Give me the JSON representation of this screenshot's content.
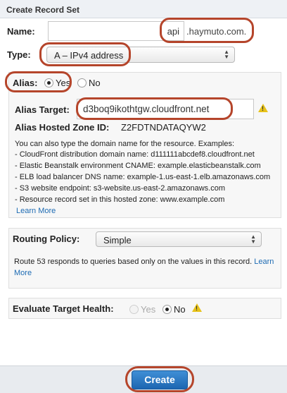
{
  "panel": {
    "title": "Create Record Set"
  },
  "name": {
    "label": "Name:",
    "value": "api",
    "suffix": ".haymuto.com."
  },
  "type": {
    "label": "Type:",
    "selected": "A – IPv4 address"
  },
  "alias": {
    "label": "Alias:",
    "yes_label": "Yes",
    "no_label": "No",
    "selected": "Yes",
    "target_label": "Alias Target:",
    "target_value": "d3boq9ikothtgw.cloudfront.net",
    "hosted_zone_label": "Alias Hosted Zone ID:",
    "hosted_zone_value": "Z2FDTNDATAQYW2",
    "help_intro": "You can also type the domain name for the resource. Examples:",
    "examples": [
      "- CloudFront distribution domain name: d111111abcdef8.cloudfront.net",
      "- Elastic Beanstalk environment CNAME: example.elasticbeanstalk.com",
      "- ELB load balancer DNS name: example-1.us-east-1.elb.amazonaws.com",
      "- S3 website endpoint: s3-website.us-east-2.amazonaws.com",
      "- Resource record set in this hosted zone: www.example.com"
    ],
    "learn_more": "Learn More",
    "warning_icon": "warning-icon"
  },
  "routing": {
    "label": "Routing Policy:",
    "selected": "Simple",
    "description": "Route 53 responds to queries based only on the values in this record.",
    "learn_more": "Learn More"
  },
  "health": {
    "label": "Evaluate Target Health:",
    "yes_label": "Yes",
    "no_label": "No",
    "selected": "No"
  },
  "footer": {
    "create_label": "Create"
  },
  "colors": {
    "highlight_ring": "#b5452b",
    "button": "#2a78c4",
    "link": "#1d6bb3",
    "warning": "#e7c21a"
  }
}
